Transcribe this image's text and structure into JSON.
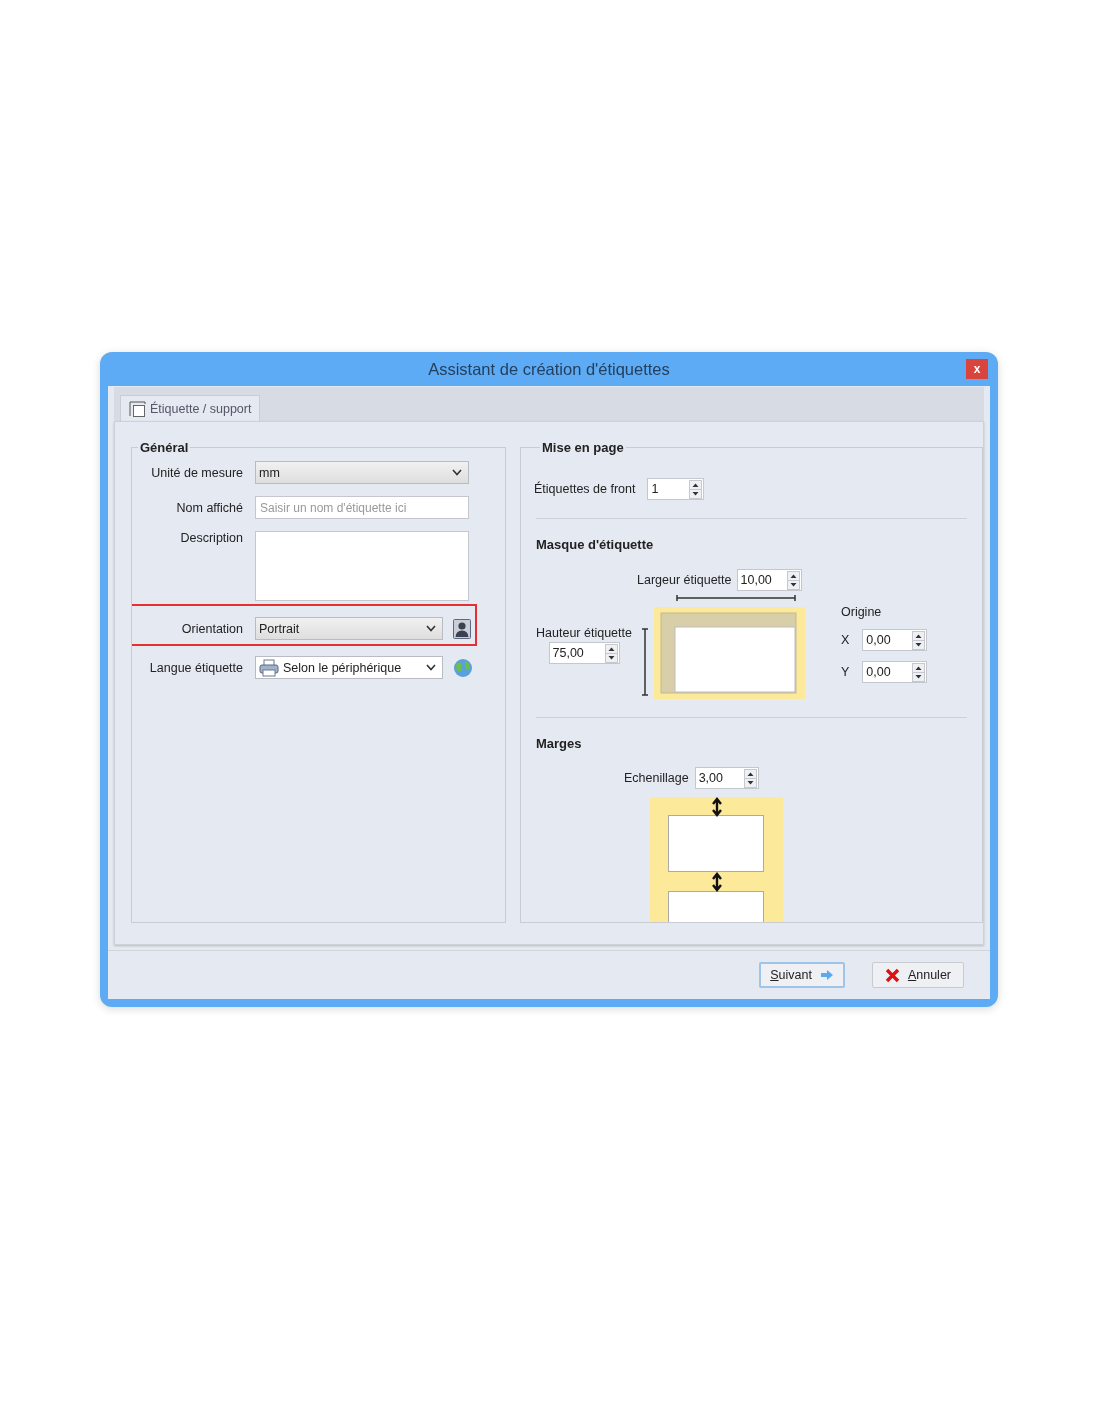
{
  "window": {
    "title": "Assistant de création d'étiquettes",
    "close": "x"
  },
  "tabs": [
    {
      "label": "Étiquette / support",
      "selected": true
    }
  ],
  "general": {
    "title": "Général",
    "fields": [
      {
        "kind": "select",
        "label": "Unité de mesure",
        "value": "mm",
        "highlighted": false
      },
      {
        "kind": "text",
        "label": "Nom affiché",
        "placeholder": "Saisir un nom d'étiquette ici",
        "highlighted": false
      },
      {
        "kind": "textarea",
        "label": "Description",
        "highlighted": false
      },
      {
        "kind": "orientation",
        "label": "Orientation",
        "value": "Portrait",
        "highlighted": true
      },
      {
        "kind": "language",
        "label": "Langue étiquette",
        "value": "Selon le périphérique",
        "highlighted": false
      }
    ]
  },
  "layout": {
    "title": "Mise en page",
    "front": {
      "label": "Étiquettes de front",
      "value": "1"
    },
    "mask": {
      "title": "Masque d'étiquette",
      "width": {
        "label": "Largeur étiquette",
        "value": "10,00"
      },
      "height": {
        "label": "Hauteur étiquette",
        "value": "75,00"
      },
      "origin": {
        "title": "Origine",
        "x": {
          "label": "X",
          "value": "0,00"
        },
        "y": {
          "label": "Y",
          "value": "0,00"
        }
      }
    },
    "margins": {
      "title": "Marges",
      "gap": {
        "label": "Echenillage",
        "value": "3,00"
      }
    }
  },
  "buttons": [
    {
      "kind": "next",
      "label": "Suivant",
      "default": true
    },
    {
      "kind": "cancel",
      "label": "Annuler",
      "default": false
    }
  ]
}
